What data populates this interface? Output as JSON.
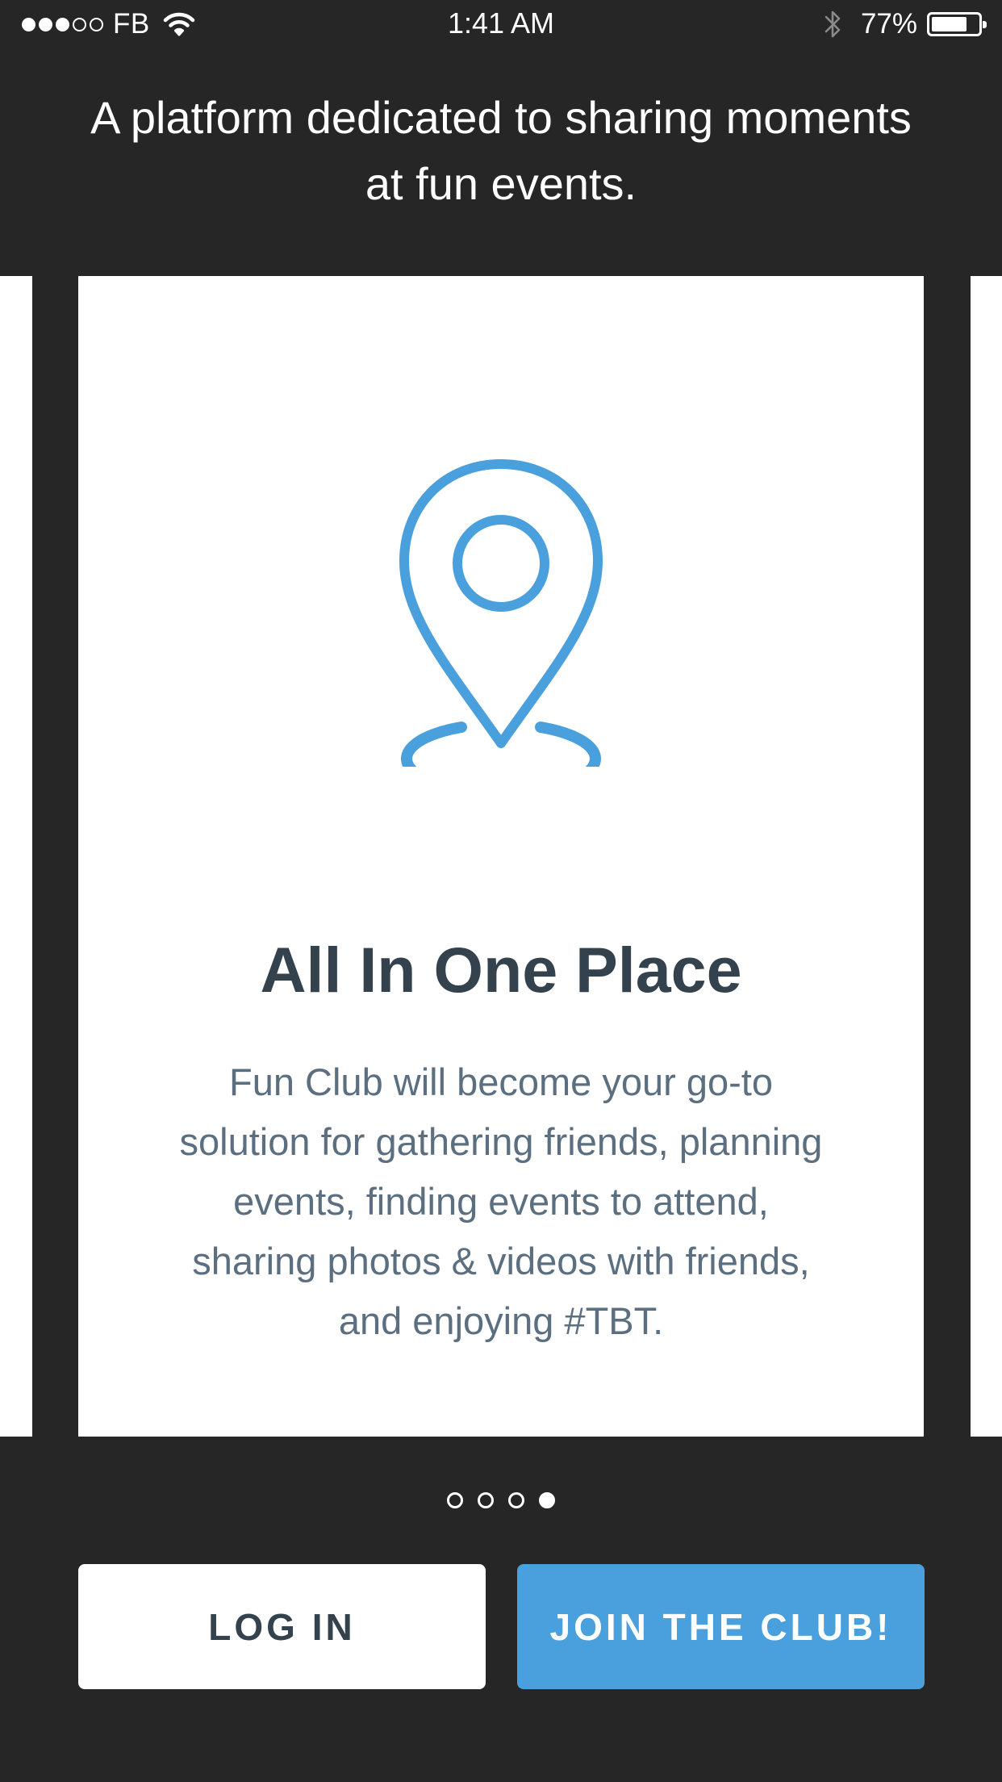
{
  "status_bar": {
    "carrier": "FB",
    "time": "1:41 AM",
    "battery_percent": "77%",
    "battery_level": 0.77,
    "signal_bars_filled": 3,
    "signal_bars_total": 5,
    "icons": [
      "wifi-icon",
      "bluetooth-icon",
      "battery-icon"
    ]
  },
  "header": {
    "tagline": "A platform dedicated to sharing moments at fun events."
  },
  "carousel": {
    "active_index": 3,
    "page_count": 4,
    "slide": {
      "icon": "location-pin-icon",
      "title": "All In One Place",
      "body": "Fun Club will become your go-to solution for gathering friends, planning events, finding events to attend, sharing photos & videos with friends, and enjoying #TBT."
    }
  },
  "actions": {
    "login_label": "LOG IN",
    "join_label": "JOIN THE CLUB!"
  },
  "colors": {
    "background": "#262626",
    "card": "#ffffff",
    "accent": "#4a9fdd",
    "title_text": "#34424e",
    "body_text": "#5b6f80"
  }
}
